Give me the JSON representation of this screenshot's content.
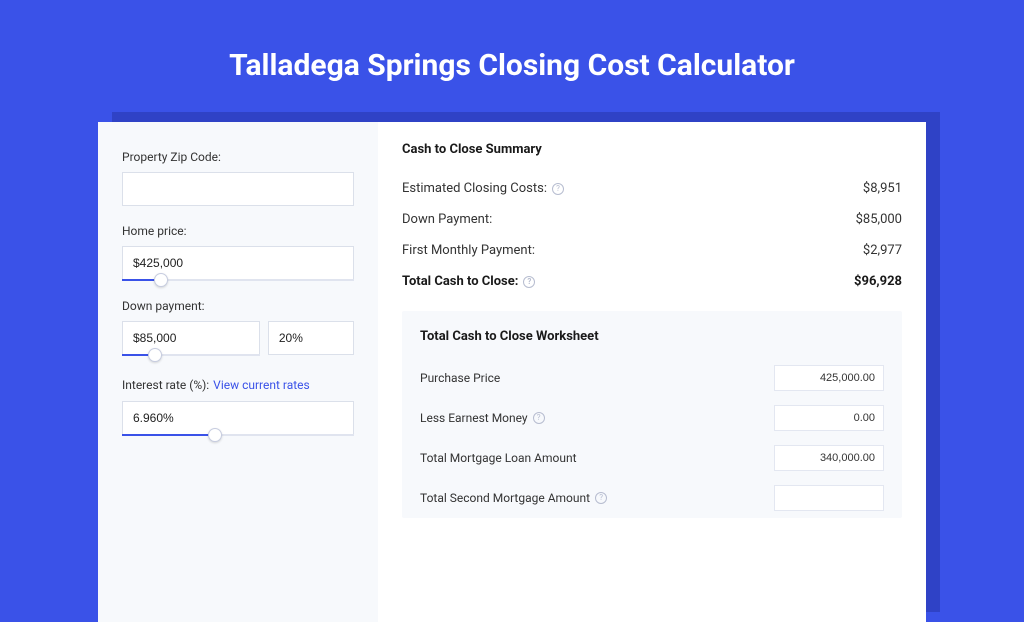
{
  "page_title": "Talladega Springs Closing Cost Calculator",
  "sidebar": {
    "zip_label": "Property Zip Code:",
    "zip_value": "",
    "home_price_label": "Home price:",
    "home_price_value": "$425,000",
    "down_payment_label": "Down payment:",
    "down_payment_value": "$85,000",
    "down_payment_pct": "20%",
    "interest_label": "Interest rate (%):",
    "interest_link": "View current rates",
    "interest_value": "6.960%"
  },
  "summary": {
    "title": "Cash to Close Summary",
    "rows": [
      {
        "label": "Estimated Closing Costs:",
        "value": "$8,951",
        "help": true
      },
      {
        "label": "Down Payment:",
        "value": "$85,000",
        "help": false
      },
      {
        "label": "First Monthly Payment:",
        "value": "$2,977",
        "help": false
      }
    ],
    "total_label": "Total Cash to Close:",
    "total_value": "$96,928"
  },
  "worksheet": {
    "title": "Total Cash to Close Worksheet",
    "rows": [
      {
        "label": "Purchase Price",
        "value": "425,000.00",
        "help": false
      },
      {
        "label": "Less Earnest Money",
        "value": "0.00",
        "help": true
      },
      {
        "label": "Total Mortgage Loan Amount",
        "value": "340,000.00",
        "help": false
      },
      {
        "label": "Total Second Mortgage Amount",
        "value": "",
        "help": true
      }
    ]
  },
  "sliders": {
    "home_price_pct": "17%",
    "down_payment_pct": "24%",
    "interest_pct": "40%"
  }
}
